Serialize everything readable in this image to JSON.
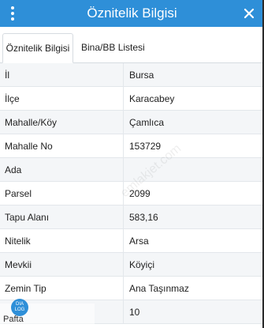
{
  "header": {
    "title": "Öznitelik Bilgisi",
    "menu_icon": "more-vertical-icon",
    "close_icon": "close-icon"
  },
  "tabs": [
    {
      "label": "Öznitelik Bilgisi",
      "active": true
    },
    {
      "label": "Bina/BB Listesi",
      "active": false
    }
  ],
  "rows": [
    {
      "label": "İl",
      "value": "Bursa"
    },
    {
      "label": "İlçe",
      "value": "Karacabey"
    },
    {
      "label": "Mahalle/Köy",
      "value": "Çamlıca"
    },
    {
      "label": "Mahalle No",
      "value": "153729"
    },
    {
      "label": "Ada",
      "value": ""
    },
    {
      "label": "Parsel",
      "value": "2099"
    },
    {
      "label": "Tapu Alanı",
      "value": "583,16"
    },
    {
      "label": "Nitelik",
      "value": "Arsa"
    },
    {
      "label": "Mevkii",
      "value": "Köyiçi"
    },
    {
      "label": "Zemin Tip",
      "value": "Ana Taşınmaz"
    },
    {
      "label": "",
      "value": "10"
    }
  ],
  "watermark": {
    "text": "emlakjet.com"
  },
  "logo": {
    "badge": "DIA\nLOG",
    "text": "Pafta"
  },
  "colors": {
    "header_bg": "#2e8fd8",
    "row_alt_bg": "#f4f6f8"
  }
}
